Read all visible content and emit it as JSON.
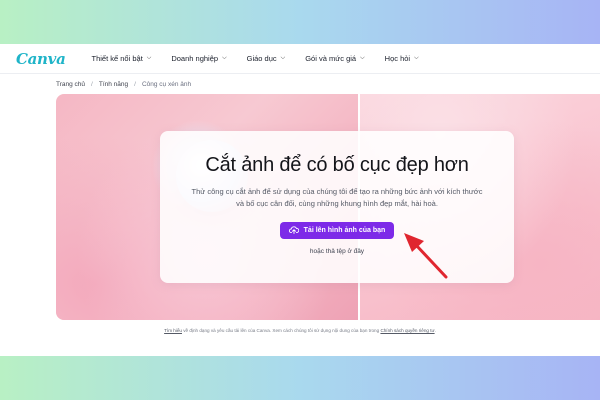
{
  "brand": {
    "logo": "Canva"
  },
  "nav": [
    {
      "label": "Thiết kế nổi bật"
    },
    {
      "label": "Doanh nghiệp"
    },
    {
      "label": "Giáo dục"
    },
    {
      "label": "Gói và mức giá"
    },
    {
      "label": "Học hỏi"
    }
  ],
  "breadcrumb": {
    "home": "Trang chủ",
    "features": "Tính năng",
    "current": "Công cụ xén ảnh",
    "separator": "/"
  },
  "hero": {
    "title": "Cắt ảnh để có bố cục đẹp hơn",
    "description": "Thử công cụ cắt ảnh để sử dụng của chúng tôi để tạo ra những bức ảnh với kích thước và bố cục cân đối, cùng những khung hình đẹp mắt, hài hoà.",
    "upload_label": "Tải lên hình ảnh của bạn",
    "drop_text": "hoặc thả tệp ở đây"
  },
  "footnote": {
    "link1": "Tìm hiểu",
    "middle": " về định dạng và yêu cầu tải lên của Canva. Xem cách chúng tôi sử dụng nội dung của bạn trong ",
    "link2": "Chính sách quyền riêng tư",
    "end": "."
  },
  "colors": {
    "accent": "#7d2ae8",
    "logo": "#1fb4c8",
    "arrow": "#e0262f"
  },
  "icons": {
    "upload": "cloud-upload-icon",
    "dropdown": "chevron-down-icon",
    "annotation": "red-arrow"
  }
}
